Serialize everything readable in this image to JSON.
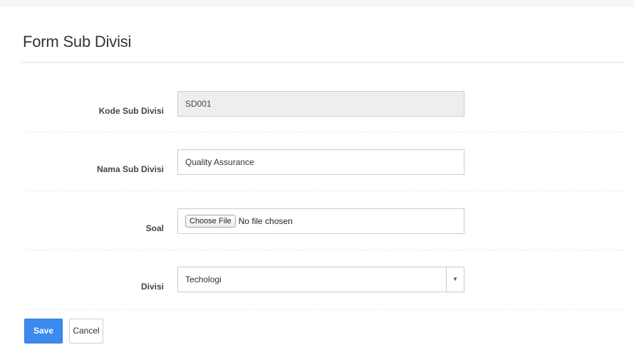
{
  "form": {
    "title": "Form Sub Divisi"
  },
  "fields": {
    "kode": {
      "label": "Kode Sub Divisi",
      "value": "SD001"
    },
    "nama": {
      "label": "Nama Sub Divisi",
      "value": "Quality Assurance"
    },
    "soal": {
      "label": "Soal",
      "button_label": "Choose File",
      "status": "No file chosen"
    },
    "divisi": {
      "label": "Divisi",
      "selected": "Techologi"
    }
  },
  "actions": {
    "save_label": "Save",
    "cancel_label": "Cancel"
  },
  "icons": {
    "select_caret": "chevron-down-icon"
  },
  "colors": {
    "primary": "#3b8af0",
    "disabled_bg": "#eeeeee"
  }
}
